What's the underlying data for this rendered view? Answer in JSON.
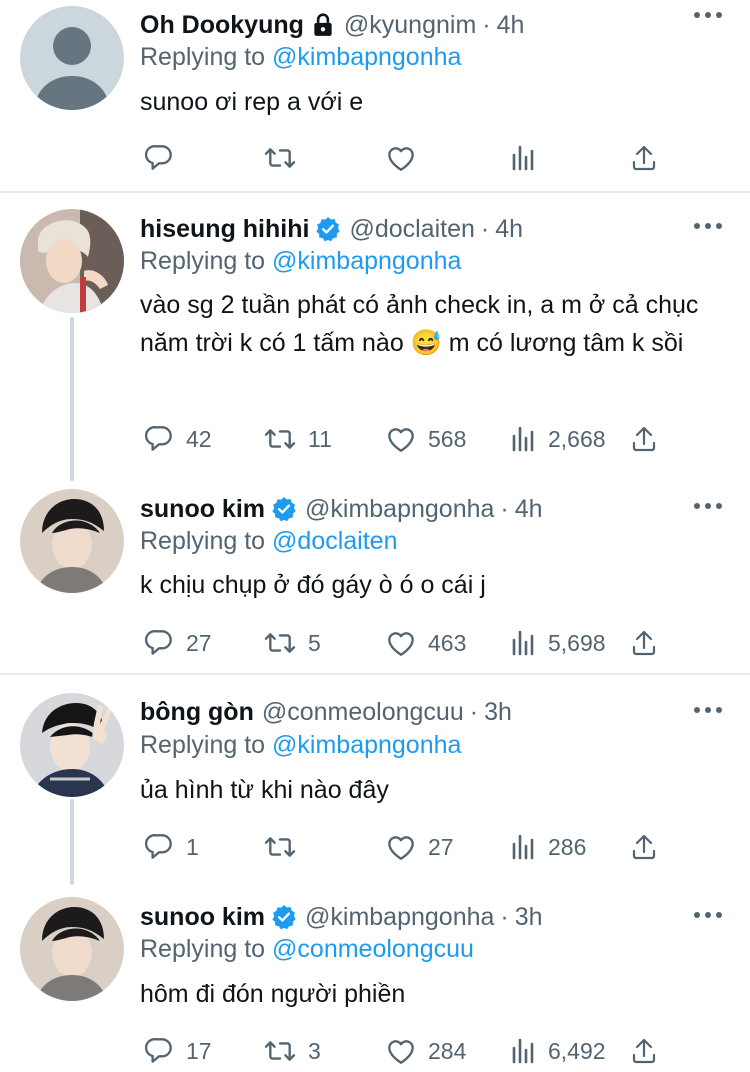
{
  "tweets": [
    {
      "name": "Oh Dookyung",
      "handle": "@kyungnim",
      "time": "4h",
      "replying_label": "Replying to",
      "replying_to": "@kimbapngonha",
      "text": "sunoo ơi rep a với e",
      "replies": "",
      "retweets": "",
      "likes": "",
      "views": "",
      "badge": "lock-icon"
    },
    {
      "name": "hiseung hihihi",
      "handle": "@doclaiten",
      "time": "4h",
      "replying_label": "Replying to",
      "replying_to": "@kimbapngonha",
      "text": "vào sg 2 tuần phát có ảnh check in, a m ở cả chục năm trời k có 1 tấm nào 😅  m có lương tâm k sồi",
      "replies": "42",
      "retweets": "11",
      "likes": "568",
      "views": "2,668",
      "badge": "verified-icon"
    },
    {
      "name": "sunoo kim",
      "handle": "@kimbapngonha",
      "time": "4h",
      "replying_label": "Replying to",
      "replying_to": "@doclaiten",
      "text": "k chịu chụp ở đó gáy ò ó o cái j",
      "replies": "27",
      "retweets": "5",
      "likes": "463",
      "views": "5,698",
      "badge": "verified-icon"
    },
    {
      "name": "bông gòn",
      "handle": "@conmeolongcuu",
      "time": "3h",
      "replying_label": "Replying to",
      "replying_to": "@kimbapngonha",
      "text": "ủa hình từ khi nào đây",
      "replies": "1",
      "retweets": "",
      "likes": "27",
      "views": "286",
      "badge": ""
    },
    {
      "name": "sunoo kim",
      "handle": "@kimbapngonha",
      "time": "3h",
      "replying_label": "Replying to",
      "replying_to": "@conmeolongcuu",
      "text": "hôm đi đón người phiền",
      "replies": "17",
      "retweets": "3",
      "likes": "284",
      "views": "6,492",
      "badge": "verified-icon"
    }
  ],
  "colors": {
    "link": "#1d9bf0",
    "muted": "#536471",
    "verified": "#1d9bf0",
    "text": "#0f1419"
  }
}
